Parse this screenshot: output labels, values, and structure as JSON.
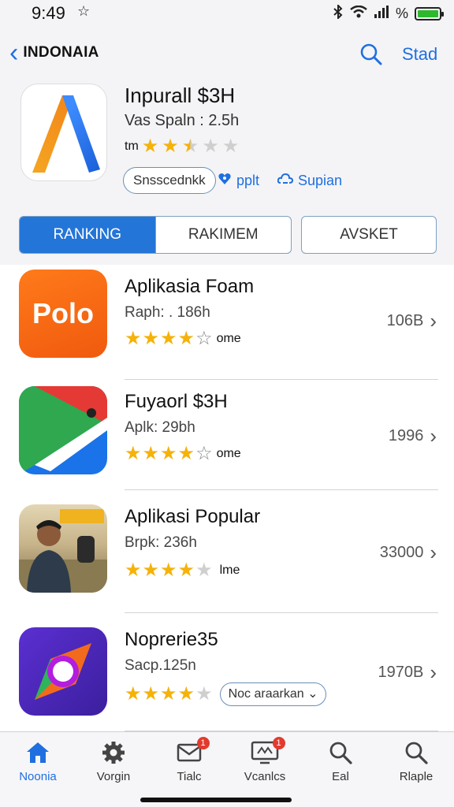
{
  "status_bar": {
    "time": "9:49",
    "battery_label": "%"
  },
  "nav": {
    "back_label": "INDONAIA",
    "action_label": "Stad"
  },
  "featured": {
    "name": "Inpurall $3H",
    "subtitle": "Vas Spaln : 2.5h",
    "rating_prefix": "tm",
    "rating": 2.5,
    "pill_label": "Snsscednkk",
    "link1": "pplt",
    "link2": "Supian"
  },
  "segments": [
    "RANKING",
    "RAKIMEM",
    "AVSKET"
  ],
  "apps": [
    {
      "name": "Aplikasia Foam",
      "sub": "Raph: . 186h",
      "stars_label": "ome",
      "rating": 4,
      "count": "106B",
      "icon_text": "Polo"
    },
    {
      "name": "Fuyaorl $3H",
      "sub": "Aplk: 29bh",
      "stars_label": "ome",
      "rating": 4,
      "count": "1996"
    },
    {
      "name": "Aplikasi Popular",
      "sub": "Brpk: 236h",
      "stars_label": "lme",
      "rating": 4,
      "count": "33000"
    },
    {
      "name": "Noprerie35",
      "sub": "Sacp.125n",
      "button_label": "Noc araarkan",
      "rating": 4,
      "count": "1970B"
    }
  ],
  "tabs": [
    {
      "label": "Noonia",
      "icon": "home-icon",
      "active": true
    },
    {
      "label": "Vorgin",
      "icon": "gear-icon"
    },
    {
      "label": "Tialc",
      "icon": "inbox-icon",
      "badge": "1"
    },
    {
      "label": "Vcanlcs",
      "icon": "monitor-icon",
      "badge": "1"
    },
    {
      "label": "Eal",
      "icon": "search-icon"
    },
    {
      "label": "Rlaple",
      "icon": "search-icon"
    }
  ],
  "colors": {
    "accent": "#2475d8",
    "star": "#f5b20a",
    "badge": "#e23b2e"
  }
}
